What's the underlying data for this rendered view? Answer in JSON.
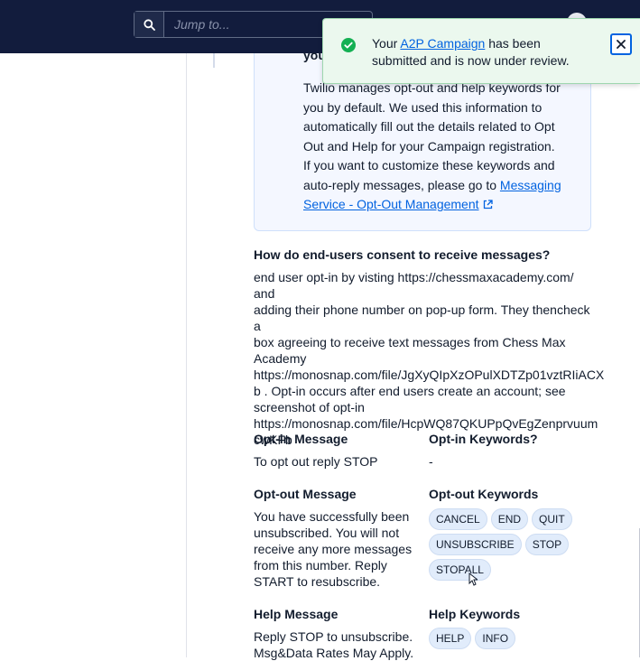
{
  "search": {
    "placeholder": "Jump to..."
  },
  "toast": {
    "prefix": "Your ",
    "link": "A2P Campaign",
    "suffix": " has been submitted and is now under review."
  },
  "infobox": {
    "partial_heading": "you",
    "text_main": "Twilio manages opt-out and help keywords for you by default. We used this information to automatically fill out the details related to Opt Out and Help for your Campaign registration.",
    "text_custom": "If you want to customize these keywords and auto-reply messages, please go to ",
    "link": "Messaging Service - Opt-Out Management"
  },
  "consent": {
    "title": "How do end-users consent to receive messages?",
    "lines": [
      "end user opt-in by visting https://chessmaxacademy.com/ and",
      "adding their phone number on pop-up form. They thencheck a",
      "box agreeing to receive text messages from Chess Max",
      "Academy",
      "https://monosnap.com/file/JgXyQIpXzOPulXDTZp01vztRIiACX",
      "b . Opt-in occurs after end users create an account; see",
      "screenshot of opt-in",
      "https://monosnap.com/file/HcpWQ87QKUPpQvEgZenprvuum",
      "cwKFb"
    ]
  },
  "optin": {
    "title": "Opt-in Message",
    "text": "To opt out reply STOP",
    "keywords_title": "Opt-in Keywords?",
    "keywords_value": "-"
  },
  "optout": {
    "title": "Opt-out Message",
    "lines": [
      "You have successfully been",
      "unsubscribed. You will not",
      "receive any more messages",
      "from this number. Reply",
      "START to resubscribe."
    ],
    "keywords_title": "Opt-out Keywords",
    "keywords": [
      "CANCEL",
      "END",
      "QUIT",
      "UNSUBSCRIBE",
      "STOP",
      "STOPALL"
    ]
  },
  "help": {
    "title": "Help Message",
    "lines": [
      "Reply STOP to unsubscribe.",
      "Msg&Data Rates May Apply."
    ],
    "keywords_title": "Help Keywords",
    "keywords": [
      "HELP",
      "INFO"
    ]
  },
  "colors": {
    "accent": "#0263e0",
    "topbar": "#121c3d",
    "success": "#14b053"
  }
}
